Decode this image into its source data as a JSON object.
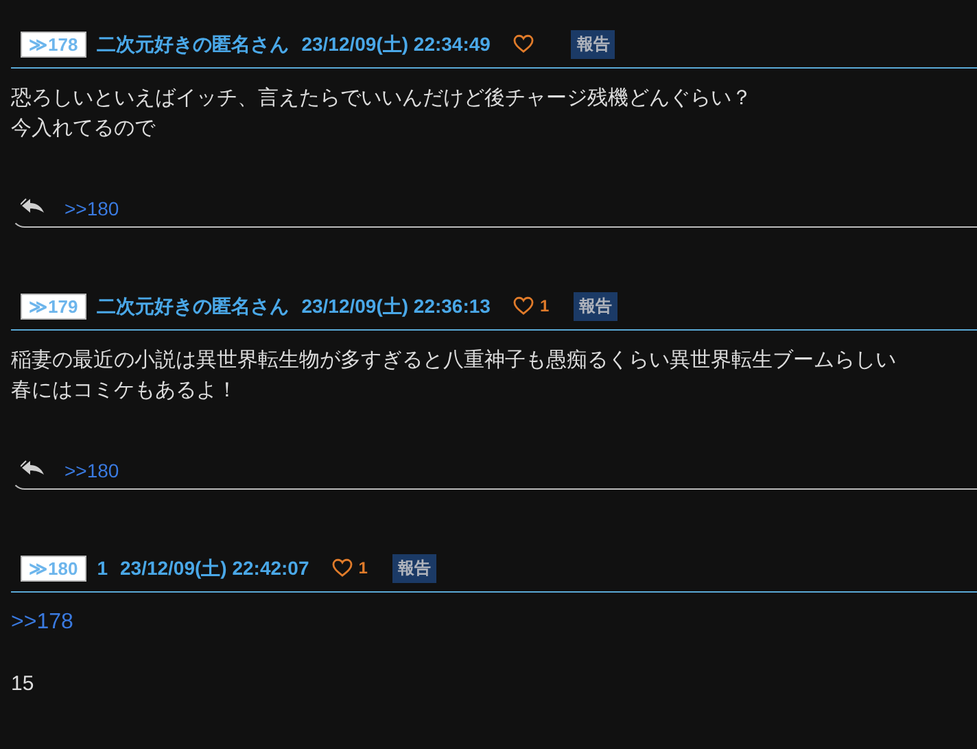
{
  "posts": [
    {
      "number": "≫178",
      "name": "二次元好きの匿名さん",
      "date": "23/12/09(土) 22:34:49",
      "report": "報告",
      "body": [
        {
          "kind": "text",
          "text": "恐ろしいといえばイッチ、言えたらでいいんだけど後チャージ残機どんぐらい？"
        },
        {
          "kind": "text",
          "text": "今入れてるので"
        }
      ],
      "replies": [
        ">>180"
      ]
    },
    {
      "number": "≫179",
      "name": "二次元好きの匿名さん",
      "date": "23/12/09(土) 22:36:13",
      "likes": "1",
      "report": "報告",
      "body": [
        {
          "kind": "text",
          "text": "稲妻の最近の小説は異世界転生物が多すぎると八重神子も愚痴るくらい異世界転生ブームらしい"
        },
        {
          "kind": "text",
          "text": "春にはコミケもあるよ！"
        }
      ],
      "replies": [
        ">>180"
      ]
    },
    {
      "number": "≫180",
      "name": "1",
      "date": "23/12/09(土) 22:42:07",
      "likes": "1",
      "report": "報告",
      "body": [
        {
          "kind": "link",
          "text": ">>178"
        },
        {
          "kind": "text",
          "text": "15"
        }
      ]
    }
  ]
}
